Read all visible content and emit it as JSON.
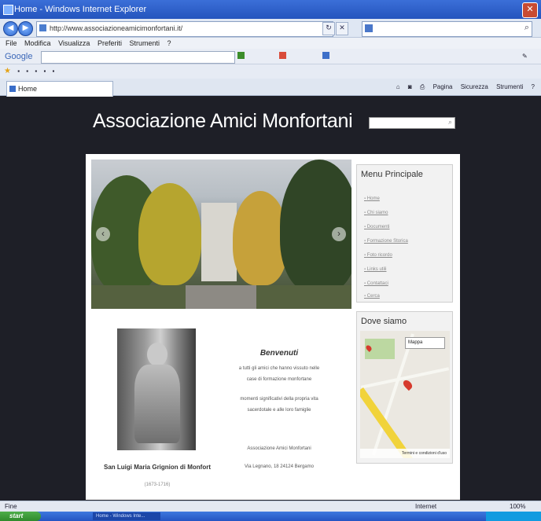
{
  "browser": {
    "title": "Home - Windows Internet Explorer",
    "address": "http://www.associazioneamicimonfortani.it/",
    "menu": [
      "File",
      "Modifica",
      "Visualizza",
      "Preferiti",
      "Strumenti",
      "?"
    ],
    "google_label": "Google",
    "tab_title": "Home",
    "cmd_items": [
      "Pagina",
      "Sicurezza",
      "Strumenti"
    ],
    "status_left": "Fine",
    "status_zone": "Internet",
    "zoom": "100%",
    "start_label": "start",
    "task_item": "Home - Windows Inte..."
  },
  "site": {
    "title": "Associazione Amici Monfortani"
  },
  "menu_box": {
    "title": "Menu Principale",
    "items": [
      "Home",
      "Chi siamo",
      "Documenti",
      "Formazione Storica",
      "Foto ricordo",
      "Links utili",
      "Contattaci",
      "Cerca"
    ]
  },
  "map_box": {
    "title": "Dove siamo",
    "select_value": "Mappa",
    "footer": "Termini e condizioni d'uso"
  },
  "welcome": {
    "title": "Benvenuti",
    "lines": [
      "a tutti gli amici che hanno vissuto nelle",
      "case di formazione monfortane",
      "momenti significativi della propria vita",
      "sacerdotale e alle loro famiglie",
      "Associazione Amici Monfortani",
      "Via Legnano, 18 24124 Bergamo"
    ],
    "caption": "San Luigi Maria Grignion di Monfort",
    "caption_sub": "(1673-1716)"
  }
}
